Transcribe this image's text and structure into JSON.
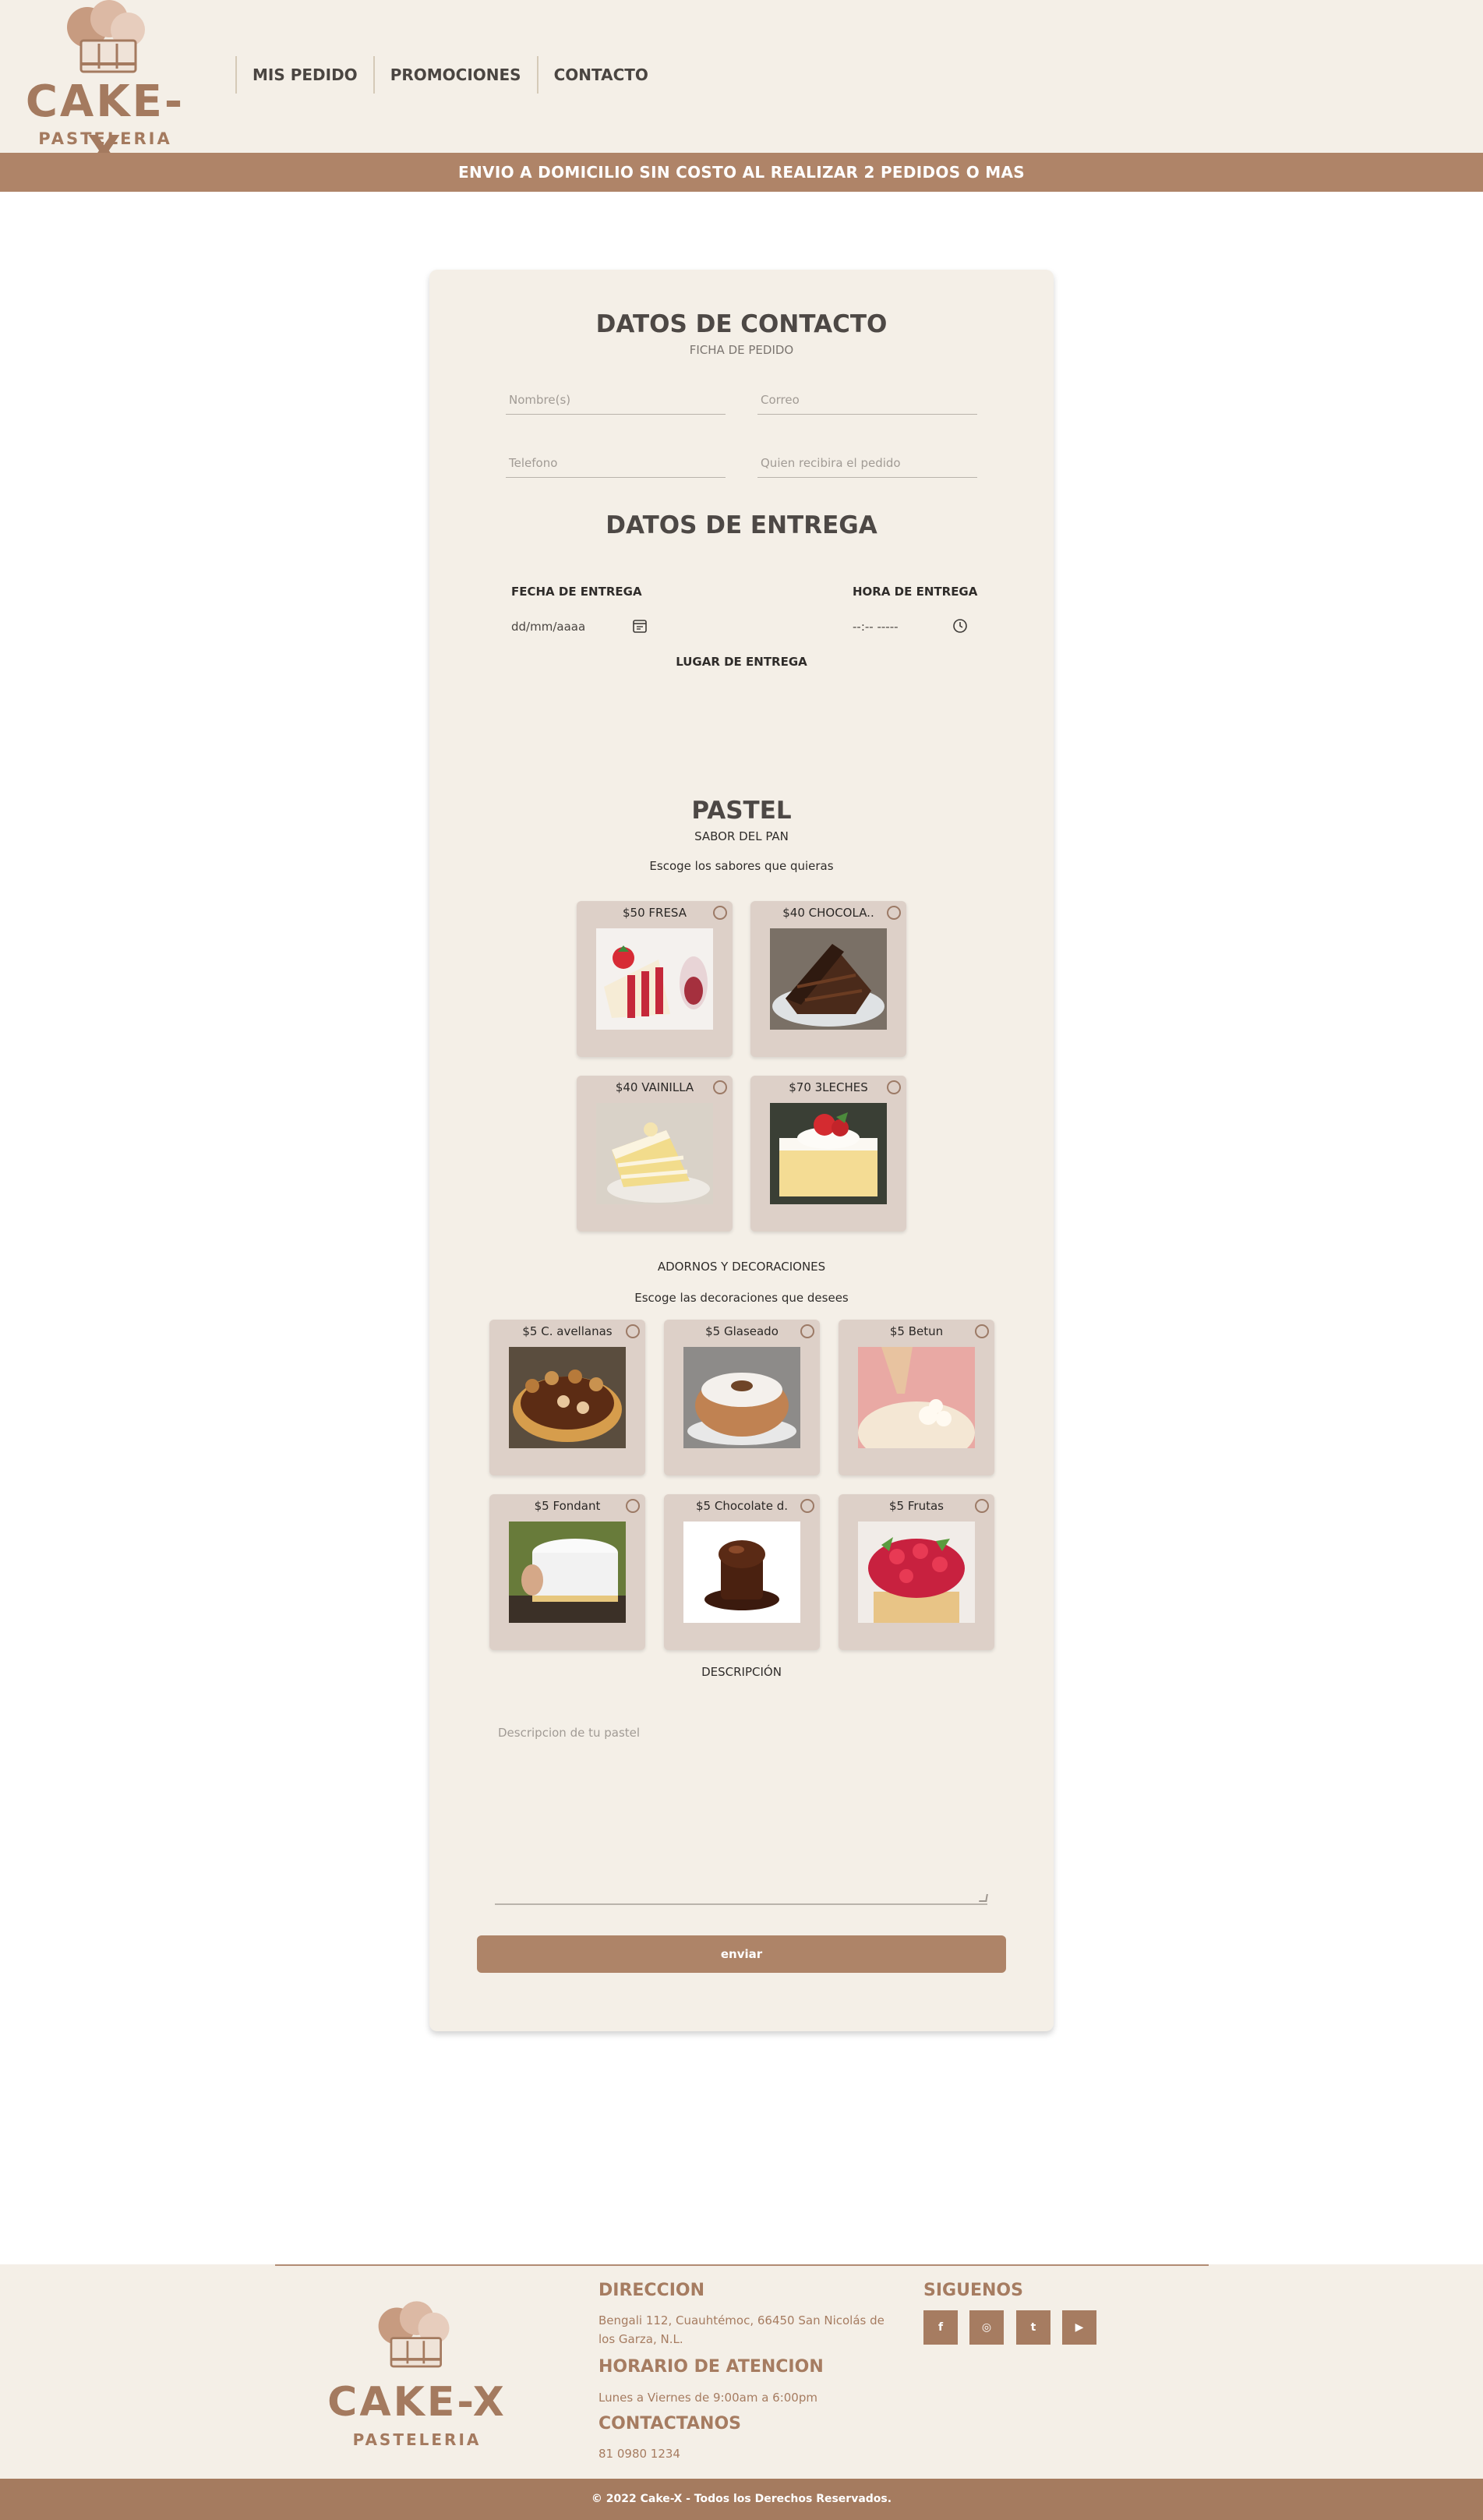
{
  "header": {
    "brand": "CAKE-X",
    "brand_sub": "PASTELERIA",
    "nav": [
      "MIS PEDIDO",
      "PROMOCIONES",
      "CONTACTO"
    ],
    "banner": "ENVIO A DOMICILIO SIN COSTO AL REALIZAR 2 PEDIDOS O MAS"
  },
  "contact": {
    "title": "DATOS DE CONTACTO",
    "subtitle": "FICHA DE PEDIDO",
    "name_placeholder": "Nombre(s)",
    "email_placeholder": "Correo",
    "phone_placeholder": "Telefono",
    "receiver_placeholder": "Quien recibira el pedido"
  },
  "delivery": {
    "title": "DATOS DE ENTREGA",
    "date_label": "FECHA DE ENTREGA",
    "date_value": "dd/mm/aaaa",
    "time_label": "HORA DE ENTREGA",
    "time_value": "--:-- -----",
    "place_label": "LUGAR DE ENTREGA"
  },
  "cake": {
    "title": "PASTEL",
    "subtitle": "SABOR DEL PAN",
    "prompt": "Escoge los sabores que quieras",
    "flavors": [
      "$50 FRESA",
      "$40 CHOCOLA..",
      "$40 VAINILLA",
      "$70 3LECHES"
    ]
  },
  "decor": {
    "title": "ADORNOS Y DECORACIONES",
    "prompt": "Escoge las decoraciones que desees",
    "items": [
      "$5 C. avellanas",
      "$5 Glaseado",
      "$5 Betun",
      "$5 Fondant",
      "$5 Chocolate d.",
      "$5 Frutas"
    ]
  },
  "description": {
    "title": "DESCRIPCIÓN",
    "placeholder": "Descripcion de tu pastel"
  },
  "submit_label": "enviar",
  "footer": {
    "brand": "CAKE-X",
    "brand_sub": "PASTELERIA",
    "address_title": "DIRECCION",
    "address": "Bengali 112, Cuauhtémoc, 66450 San Nicolás de los Garza, N.L.",
    "hours_title": "HORARIO DE ATENCION",
    "hours": "Lunes a Viernes de 9:00am a 6:00pm",
    "contact_title": "CONTACTANOS",
    "phone": "81 0980 1234",
    "social_title": "SIGUENOS",
    "social_icons": [
      "facebook-icon",
      "instagram-icon",
      "twitter-icon",
      "youtube-icon"
    ],
    "social_glyphs": [
      "f",
      "◎",
      "t",
      "▶"
    ],
    "copyright": "© 2022 Cake-X - Todos los Derechos Reservados."
  },
  "colors": {
    "accent": "#af8468",
    "background": "#f4efe7",
    "option_card": "#ddd0c8"
  }
}
